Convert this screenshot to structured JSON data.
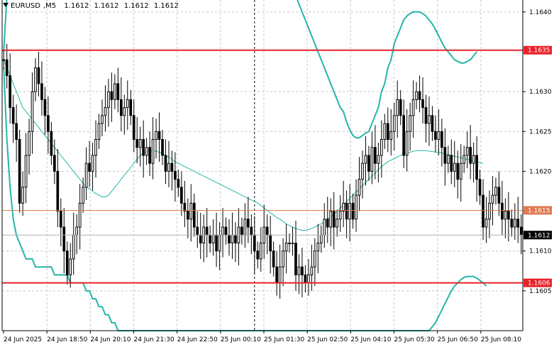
{
  "chart_data": {
    "type": "candlestick",
    "symbol": "EURUSD",
    "timeframe": "M5",
    "ohlc_header": {
      "open": "1.1612",
      "high": "1.1612",
      "low": "1.1612",
      "close": "1.1612"
    },
    "ylim": [
      1.16,
      1.16415
    ],
    "y_ticks": [
      "1.1640",
      "1.1630",
      "1.1625",
      "1.1620",
      "1.1610",
      "1.1605"
    ],
    "x_ticks": [
      "24 Jun 2025",
      "24 Jun 18:50",
      "24 Jun 20:10",
      "24 Jun 21:30",
      "24 Jun 22:50",
      "25 Jun 00:10",
      "25 Jun 01:30",
      "25 Jun 02:50",
      "25 Jun 04:10",
      "25 Jun 05:30",
      "25 Jun 06:50",
      "25 Jun 08:10"
    ],
    "price_lines": [
      {
        "label": "1.1635",
        "value": 1.16352,
        "color": "#e8222a",
        "width": 2
      },
      {
        "label": "1.1615",
        "value": 1.16151,
        "color": "#e07a50",
        "width": 1
      },
      {
        "label": "1.1606",
        "value": 1.1606,
        "color": "#e8222a",
        "width": 2
      }
    ],
    "current_price": {
      "label": "1.1612",
      "value": 1.1612,
      "color": "#000000"
    },
    "vertical_marker_index": 79,
    "closes": [
      1.1634,
      1.1632,
      1.1628,
      1.1626,
      1.1624,
      1.1616,
      1.1618,
      1.1622,
      1.1625,
      1.163,
      1.1633,
      1.1631,
      1.1629,
      1.1627,
      1.1625,
      1.1622,
      1.162,
      1.1615,
      1.1613,
      1.161,
      1.1607,
      1.1609,
      1.1612,
      1.1613,
      1.1616,
      1.1618,
      1.1621,
      1.162,
      1.1622,
      1.1624,
      1.1626,
      1.1627,
      1.1628,
      1.163,
      1.1629,
      1.1631,
      1.1629,
      1.1627,
      1.1628,
      1.1629,
      1.1627,
      1.1624,
      1.1623,
      1.1624,
      1.1622,
      1.1623,
      1.1621,
      1.1624,
      1.1625,
      1.1624,
      1.1622,
      1.162,
      1.1621,
      1.162,
      1.1619,
      1.1618,
      1.1616,
      1.1615,
      1.1614,
      1.1616,
      1.1613,
      1.1612,
      1.1611,
      1.1613,
      1.1612,
      1.1611,
      1.1612,
      1.161,
      1.1612,
      1.1613,
      1.1612,
      1.1611,
      1.1612,
      1.1611,
      1.1613,
      1.1612,
      1.1614,
      1.1613,
      1.1612,
      1.161,
      1.1609,
      1.1611,
      1.1613,
      1.1612,
      1.161,
      1.1608,
      1.1606,
      1.1608,
      1.161,
      1.1611,
      1.1611,
      1.1611,
      1.1607,
      1.1608,
      1.1607,
      1.1606,
      1.1607,
      1.1608,
      1.161,
      1.1611,
      1.1612,
      1.1614,
      1.1613,
      1.1615,
      1.1613,
      1.1614,
      1.1615,
      1.1616,
      1.1614,
      1.1616,
      1.1614,
      1.1617,
      1.1619,
      1.1621,
      1.1622,
      1.162,
      1.1623,
      1.1621,
      1.1622,
      1.1624,
      1.1626,
      1.1624,
      1.1625,
      1.1627,
      1.1629,
      1.1627,
      1.1622,
      1.1625,
      1.1627,
      1.1629,
      1.163,
      1.1629,
      1.1628,
      1.1626,
      1.1627,
      1.1625,
      1.1624,
      1.1625,
      1.1623,
      1.1621,
      1.1622,
      1.162,
      1.1621,
      1.1619,
      1.1621,
      1.1622,
      1.1623,
      1.1621,
      1.1622,
      1.1619,
      1.1617,
      1.1613,
      1.1614,
      1.1616,
      1.1617,
      1.1618,
      1.1616,
      1.1614,
      1.1615,
      1.1614,
      1.1613,
      1.1614,
      1.1613,
      1.1612
    ],
    "bb_upper": [
      1.1635,
      1.1642,
      1.1646,
      1.1648,
      1.1648,
      1.1649,
      1.165,
      1.1651,
      1.1652,
      1.1652,
      1.1652,
      1.1652,
      1.1652,
      1.1652,
      1.1651,
      1.1651,
      1.1651,
      1.1651,
      1.1651,
      1.165,
      1.165,
      1.165,
      1.165,
      1.165,
      1.165,
      1.1651,
      1.1651,
      1.1651,
      1.1651,
      1.1651,
      1.1651,
      1.1652,
      1.1652,
      1.1653,
      1.1653,
      1.1653,
      1.1654,
      1.1654,
      1.1654,
      1.1654,
      1.1654,
      1.1653,
      1.1653,
      1.1653,
      1.1653,
      1.1652,
      1.1652,
      1.1652,
      1.1652,
      1.1652,
      1.1651,
      1.1651,
      1.1651,
      1.1651,
      1.1651,
      1.1651,
      1.1651,
      1.1651,
      1.1651,
      1.1651,
      1.1651,
      1.1651,
      1.1651,
      1.1651,
      1.1651,
      1.1651,
      1.165,
      1.165,
      1.165,
      1.165,
      1.165,
      1.165,
      1.165,
      1.165,
      1.165,
      1.1649,
      1.1649,
      1.1649,
      1.1649,
      1.1649,
      1.1648,
      1.1648,
      1.1648,
      1.1648,
      1.1648,
      1.1648,
      1.1647,
      1.1647,
      1.1646,
      1.1645,
      1.1644,
      1.1643,
      1.1642,
      1.1641,
      1.164,
      1.1639,
      1.1638,
      1.1637,
      1.1636,
      1.1635,
      1.1634,
      1.1633,
      1.1632,
      1.1631,
      1.163,
      1.1629,
      1.1628,
      1.16275,
      1.16262,
      1.16252,
      1.16245,
      1.16242,
      1.16242,
      1.16245,
      1.16248,
      1.1625,
      1.1626,
      1.1627,
      1.1628,
      1.163,
      1.1631,
      1.1633,
      1.1634,
      1.1636,
      1.1637,
      1.1638,
      1.1639,
      1.16395,
      1.16398,
      1.164,
      1.164,
      1.164,
      1.16398,
      1.16395,
      1.1639,
      1.16385,
      1.16378,
      1.1637,
      1.16362,
      1.16355,
      1.1635,
      1.16345,
      1.1634,
      1.16338,
      1.16336,
      1.16336,
      1.16338,
      1.1634,
      1.16345,
      1.1635
    ],
    "bb_middle": [
      1.1634,
      1.1633,
      1.1632,
      1.1631,
      1.163,
      1.1629,
      1.1628,
      1.16275,
      1.1627,
      1.16265,
      1.1626,
      1.16255,
      1.1625,
      1.16245,
      1.1624,
      1.16235,
      1.1623,
      1.16225,
      1.1622,
      1.16215,
      1.1621,
      1.16205,
      1.162,
      1.16195,
      1.1619,
      1.16185,
      1.1618,
      1.16178,
      1.16175,
      1.16172,
      1.1617,
      1.16168,
      1.16168,
      1.1617,
      1.16175,
      1.1618,
      1.16185,
      1.1619,
      1.16195,
      1.162,
      1.16205,
      1.1621,
      1.16215,
      1.1622,
      1.16223,
      1.16225,
      1.16226,
      1.16226,
      1.16225,
      1.16224,
      1.16222,
      1.1622,
      1.16218,
      1.16215,
      1.16212,
      1.1621,
      1.16208,
      1.16206,
      1.16204,
      1.16202,
      1.162,
      1.16198,
      1.16196,
      1.16194,
      1.16192,
      1.1619,
      1.16188,
      1.16186,
      1.16184,
      1.16182,
      1.1618,
      1.16178,
      1.16176,
      1.16174,
      1.16172,
      1.1617,
      1.16168,
      1.16166,
      1.16164,
      1.16162,
      1.1616,
      1.16157,
      1.16154,
      1.16151,
      1.16148,
      1.16145,
      1.16142,
      1.1614,
      1.16137,
      1.16134,
      1.16132,
      1.1613,
      1.16128,
      1.16127,
      1.16126,
      1.16126,
      1.16127,
      1.16128,
      1.1613,
      1.16132,
      1.16134,
      1.16137,
      1.1614,
      1.16143,
      1.16146,
      1.1615,
      1.16154,
      1.16158,
      1.16162,
      1.16166,
      1.1617,
      1.16174,
      1.16178,
      1.16182,
      1.16186,
      1.1619,
      1.16194,
      1.16198,
      1.16202,
      1.16206,
      1.16209,
      1.16212,
      1.16214,
      1.16216,
      1.16218,
      1.1622,
      1.16222,
      1.16223,
      1.16224,
      1.16225,
      1.16226,
      1.16226,
      1.16226,
      1.16226,
      1.16225,
      1.16225,
      1.16224,
      1.16224,
      1.16223,
      1.16222,
      1.16221,
      1.1622,
      1.16219,
      1.16218,
      1.16217,
      1.16216,
      1.16215,
      1.16214,
      1.16213,
      1.16212,
      1.16211,
      1.1621
    ],
    "bb_lower": [
      1.1633,
      1.1624,
      1.1618,
      1.1614,
      1.1612,
      1.1611,
      1.161,
      1.1609,
      1.1609,
      1.1609,
      1.1608,
      1.1608,
      1.1608,
      1.1608,
      1.1608,
      1.1608,
      1.1607,
      1.1607,
      1.1607,
      1.1607,
      1.1607,
      1.1606,
      1.1606,
      1.1606,
      1.1606,
      1.1606,
      1.1605,
      1.1605,
      1.1604,
      1.1604,
      1.1603,
      1.1603,
      1.1602,
      1.1602,
      1.1601,
      1.1601,
      1.16,
      1.16,
      1.16,
      1.16,
      1.16,
      1.16,
      1.16,
      1.16,
      1.16,
      1.16,
      1.16,
      1.16,
      1.16,
      1.16,
      1.16,
      1.16,
      1.16,
      1.16,
      1.16,
      1.16,
      1.16,
      1.16,
      1.16,
      1.16,
      1.16,
      1.16,
      1.16,
      1.16,
      1.16,
      1.16,
      1.16,
      1.16,
      1.16,
      1.16,
      1.16,
      1.16,
      1.16,
      1.16,
      1.16,
      1.16,
      1.16,
      1.16,
      1.16,
      1.16,
      1.16,
      1.16,
      1.16,
      1.16,
      1.16,
      1.16,
      1.16,
      1.16,
      1.16,
      1.16,
      1.16,
      1.16,
      1.16,
      1.16,
      1.16,
      1.16,
      1.16,
      1.16,
      1.16,
      1.16,
      1.16,
      1.16,
      1.16,
      1.16,
      1.16,
      1.16,
      1.16,
      1.16,
      1.16,
      1.16,
      1.16,
      1.16,
      1.16,
      1.16,
      1.16,
      1.16,
      1.16,
      1.16,
      1.16,
      1.16,
      1.16,
      1.16,
      1.16,
      1.16,
      1.16,
      1.16,
      1.16,
      1.16,
      1.16,
      1.16,
      1.16,
      1.16,
      1.16,
      1.16,
      1.16,
      1.16005,
      1.1601,
      1.16018,
      1.16026,
      1.16034,
      1.16042,
      1.1605,
      1.16056,
      1.1606,
      1.16064,
      1.16067,
      1.16068,
      1.16068,
      1.16068,
      1.16066,
      1.16063,
      1.1606,
      1.16056
    ],
    "legend": "none",
    "grid": true,
    "colors": {
      "background": "#ffffff",
      "grid": "#c8c8c8",
      "candle": "#000000",
      "bb_outer": "#26b5a8",
      "bb_middle": "#26b5a8",
      "axis_text": "#000000"
    }
  }
}
